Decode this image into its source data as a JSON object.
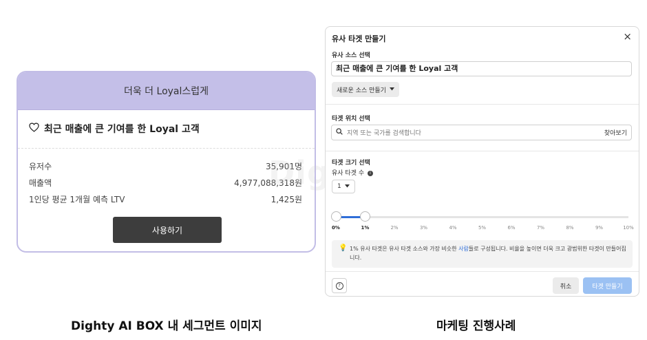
{
  "left_card": {
    "header": "더욱 더 Loyal스럽게",
    "title": "최근 매출에 큰 기여를 한 Loyal 고객",
    "stats": [
      {
        "label": "유저수",
        "value": "35,901명"
      },
      {
        "label": "매출액",
        "value": "4,977,088,318원"
      },
      {
        "label": "1인당 평균 1개월 예측 LTV",
        "value": "1,425원"
      }
    ],
    "button_label": "사용하기"
  },
  "watermark": "Dighty",
  "dialog": {
    "title": "유사 타겟 만들기",
    "close_glyph": "×",
    "source_section_label": "유사 소스 선택",
    "source_value": "최근 매출에 큰 기여를 한 Loyal 고객",
    "new_source_label": "새로운 소스 만들기",
    "location_section_label": "타겟 위치 선택",
    "search_placeholder": "지역 또는 국가를 검색합니다",
    "browse_label": "찾아보기",
    "size_section_label": "타겟 크기 선택",
    "lookalike_count_label": "유사 타겟 수",
    "lookalike_count_value": "1",
    "slider": {
      "min_percent": 0,
      "selected_percent": 1,
      "max_percent": 10,
      "ticks": [
        "0%",
        "1%",
        "2%",
        "3%",
        "4%",
        "5%",
        "6%",
        "7%",
        "8%",
        "9%",
        "10%"
      ]
    },
    "note_before": "1% 유사 타겟은 유사 타겟 소스와 가장 비슷한 ",
    "note_highlight": "사람",
    "note_after": "들로 구성됩니다. 비율을 높이면 더욱 크고 광범위한 타겟이 만들어집니다.",
    "cancel_label": "취소",
    "create_label": "타겟 만들기",
    "accent_color": "#2f6ed8",
    "create_button_color": "#9bc1f3"
  },
  "captions": {
    "left": "Dighty AI BOX 내 세그먼트 이미지",
    "right": "마케팅 진행사례"
  },
  "colors": {
    "card_header": "#c4bfe8",
    "card_border": "#c2bde6",
    "dark_button": "#3d3d3d"
  }
}
